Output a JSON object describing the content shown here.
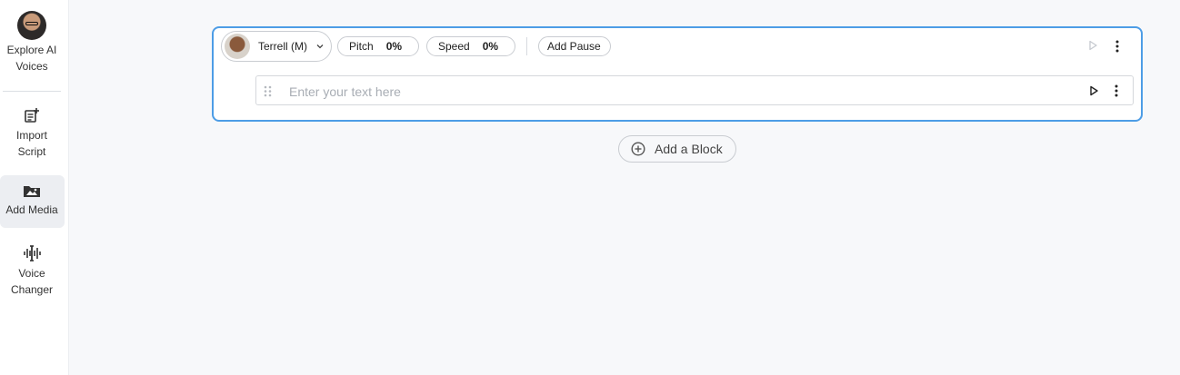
{
  "sidebar": {
    "items": [
      {
        "label_1": "Explore AI",
        "label_2": "Voices",
        "icon": "avatar"
      },
      {
        "label_1": "Import",
        "label_2": "Script",
        "icon": "import-script-icon"
      },
      {
        "label_1": "Add Media",
        "label_2": "",
        "icon": "add-media-icon",
        "active": true
      },
      {
        "label_1": "Voice",
        "label_2": "Changer",
        "icon": "voice-changer-icon"
      }
    ]
  },
  "block": {
    "voice_name": "Terrell (M)",
    "pitch_label": "Pitch",
    "pitch_value": "0%",
    "speed_label": "Speed",
    "speed_value": "0%",
    "add_pause_label": "Add Pause",
    "text_placeholder": "Enter your text here",
    "text_value": ""
  },
  "add_block_label": "Add a Block",
  "colors": {
    "accent_border": "#4d9de6",
    "background": "#f7f8fa",
    "active_sidebar": "#eceef2"
  }
}
